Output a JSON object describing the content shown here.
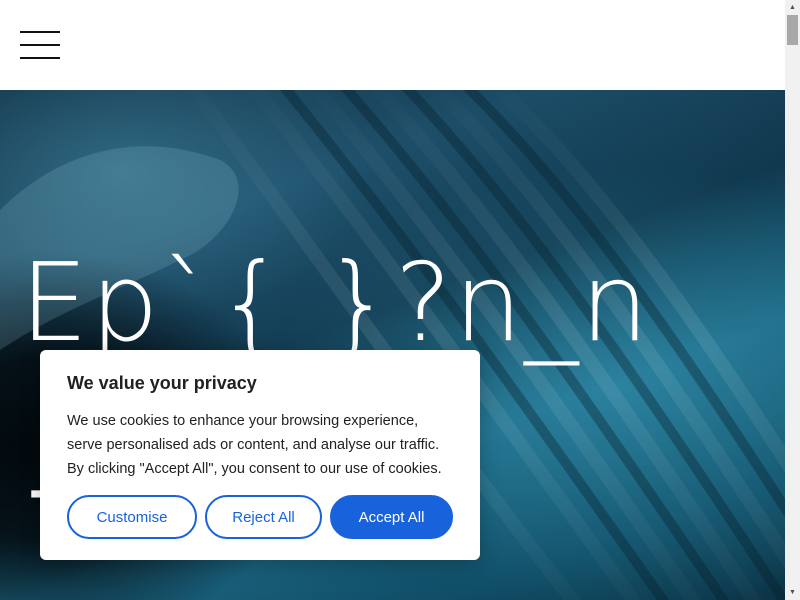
{
  "header": {
    "menu_icon": "hamburger-menu-icon"
  },
  "hero": {
    "title_line1": "Ep`{  }?n_n",
    "title_line2": "˧"
  },
  "cookie_banner": {
    "title": "We value your privacy",
    "text_lines": [
      "We use cookies to enhance your browsing experience,",
      "serve personalised ads or content, and analyse our traffic.",
      "By clicking \"Accept All\", you consent to our use of cookies."
    ],
    "buttons": {
      "customise": "Customise",
      "reject": "Reject All",
      "accept": "Accept All"
    },
    "accent_color": "#1863dc"
  },
  "scrollbar": {
    "up_icon": "scroll-up-arrow-icon",
    "down_icon": "scroll-down-arrow-icon"
  }
}
